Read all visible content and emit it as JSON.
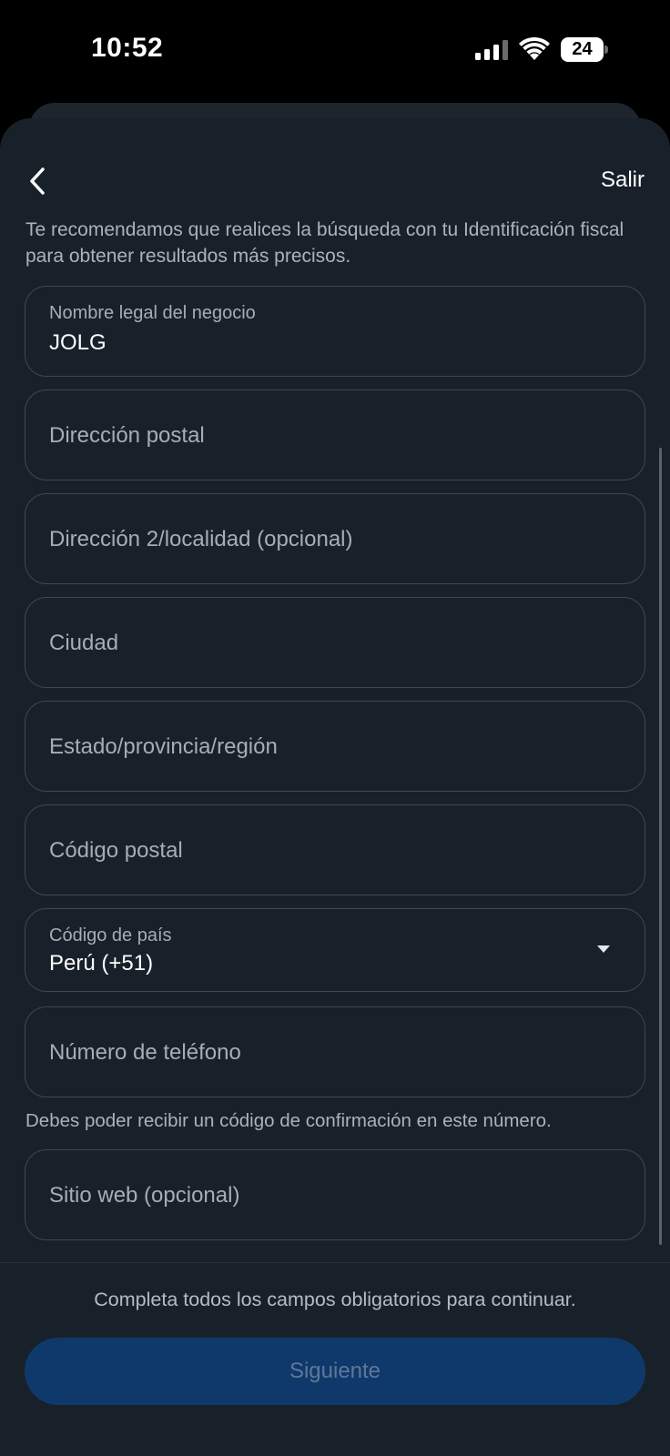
{
  "status_bar": {
    "time": "10:52",
    "battery_level": "24",
    "icons": [
      "cellular-signal-icon",
      "wifi-icon",
      "battery-icon"
    ]
  },
  "header": {
    "back_icon": "chevron-left-icon",
    "exit_label": "Salir"
  },
  "intro_text": "Te recomendamos que realices la búsqueda con tu Identificación fiscal para obtener resultados más precisos.",
  "form": {
    "business_name": {
      "label": "Nombre legal del negocio",
      "value": "JOLG"
    },
    "address": {
      "placeholder": "Dirección postal"
    },
    "address2": {
      "placeholder": "Dirección 2/localidad (opcional)"
    },
    "city": {
      "placeholder": "Ciudad"
    },
    "state": {
      "placeholder": "Estado/provincia/región"
    },
    "postal_code": {
      "placeholder": "Código postal"
    },
    "country_code": {
      "label": "Código de país",
      "value": "Perú (+51)"
    },
    "phone": {
      "placeholder": "Número de teléfono"
    },
    "phone_helper": "Debes poder recibir un código de confirmación en este número.",
    "website": {
      "placeholder": "Sitio web (opcional)"
    }
  },
  "footer": {
    "note": "Completa todos los campos obligatorios para continuar.",
    "next_label": "Siguiente"
  },
  "colors": {
    "sheet_background": "#18212a",
    "field_border": "#3e4852",
    "button_disabled": "#10396b",
    "button_text_disabled": "#5e7899"
  }
}
